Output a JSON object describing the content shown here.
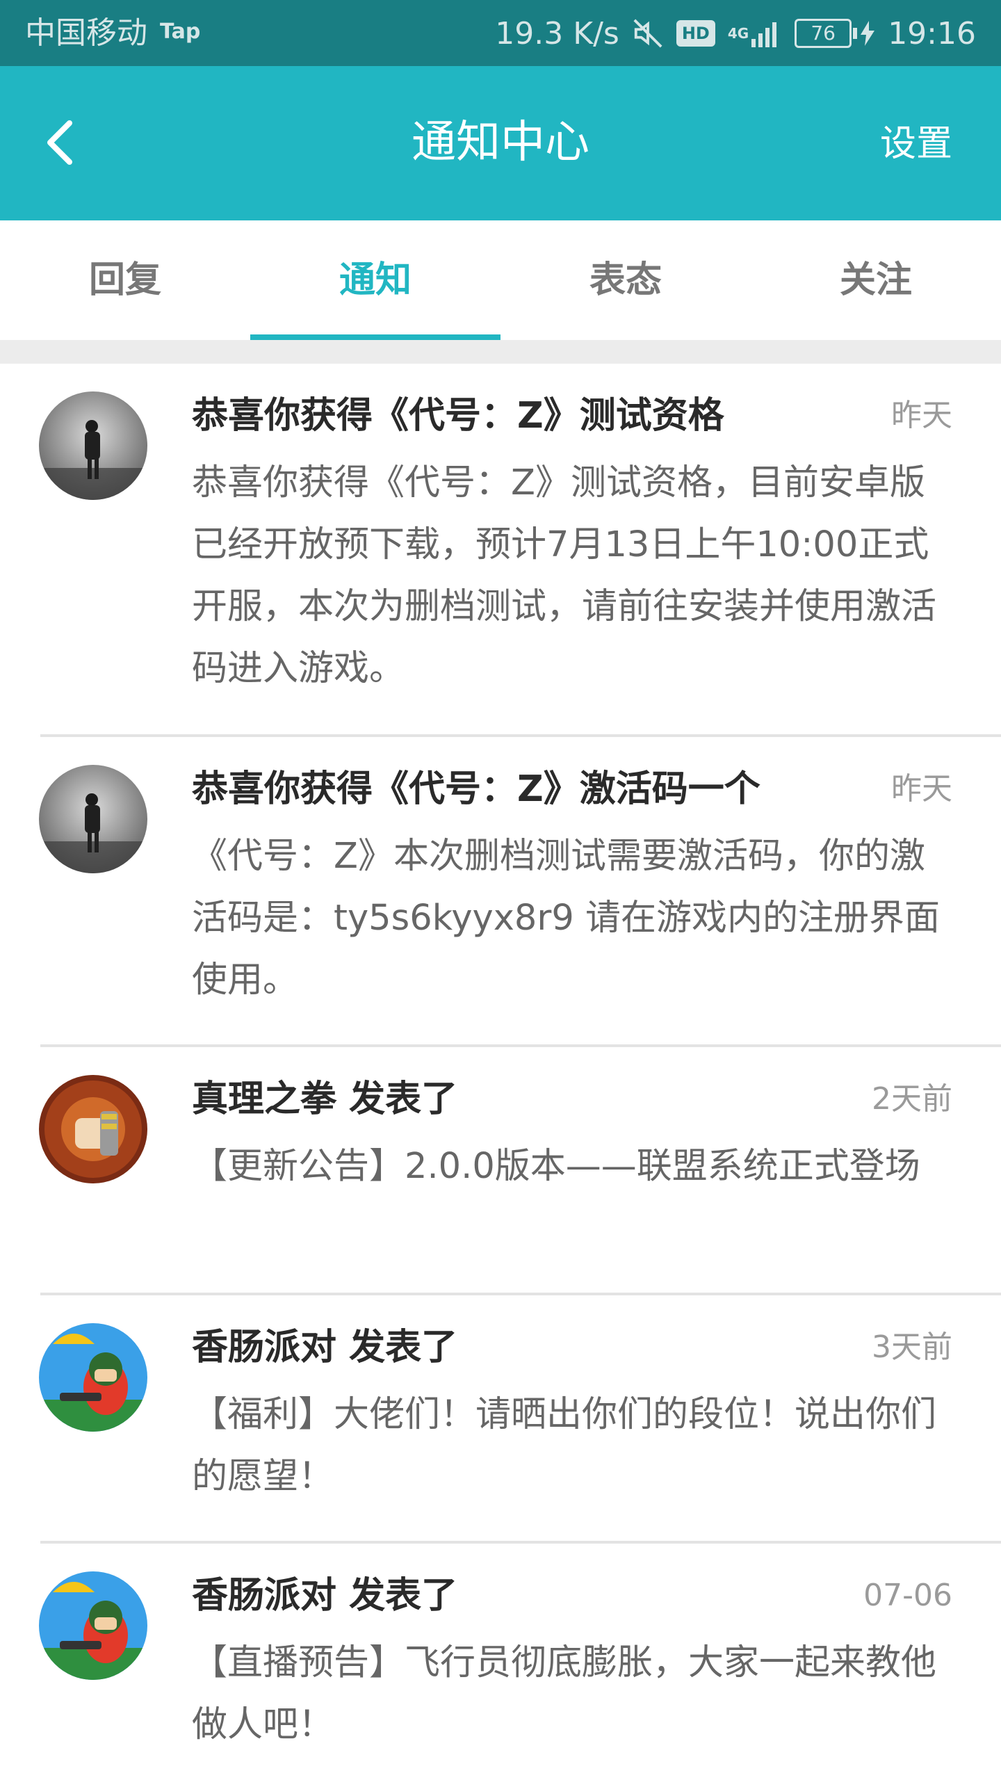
{
  "status_bar": {
    "carrier": "中国移动",
    "tap_badge": "Tap",
    "speed": "19.3 K/s",
    "hd": "HD",
    "network": "4G",
    "battery": "76",
    "time": "19:16"
  },
  "header": {
    "title": "通知中心",
    "settings": "设置"
  },
  "tabs": [
    {
      "label": "回复",
      "active": false
    },
    {
      "label": "通知",
      "active": true
    },
    {
      "label": "表态",
      "active": false
    },
    {
      "label": "关注",
      "active": false
    }
  ],
  "notifications": [
    {
      "avatar": "walking-soldier-avatar",
      "title": "恭喜你获得《代号：Z》测试资格",
      "time": "昨天",
      "body": "恭喜你获得《代号：Z》测试资格，目前安卓版已经开放预下载，预计7月13日上午10:00正式开服，本次为删档测试，请前往安装并使用激活码进入游戏。"
    },
    {
      "avatar": "walking-soldier-avatar",
      "title": "恭喜你获得《代号：Z》激活码一个",
      "time": "昨天",
      "body": "《代号：Z》本次删档测试需要激活码，你的激活码是：ty5s6kyyx8r9 请在游戏内的注册界面使用。"
    },
    {
      "avatar": "fist-avatar",
      "title": "真理之拳 发表了",
      "time": "2天前",
      "body": "【更新公告】2.0.0版本——联盟系统正式登场"
    },
    {
      "avatar": "sausage-party-avatar",
      "title": "香肠派对 发表了",
      "time": "3天前",
      "body": "【福利】大佬们！请晒出你们的段位！说出你们的愿望！"
    },
    {
      "avatar": "sausage-party-avatar",
      "title": "香肠派对 发表了",
      "time": "07-06",
      "body": "【直播预告】飞行员彻底膨胀，大家一起来教他做人吧！"
    }
  ]
}
